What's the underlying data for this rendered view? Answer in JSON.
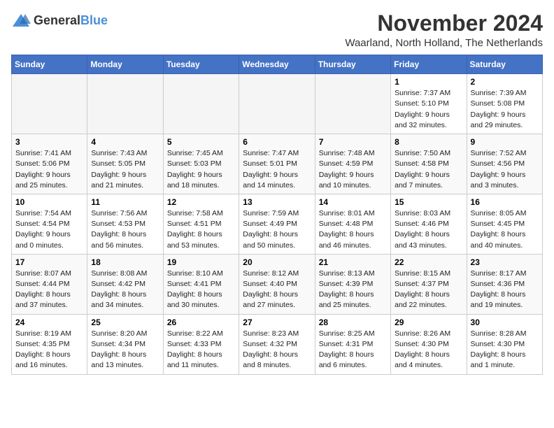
{
  "logo": {
    "general": "General",
    "blue": "Blue"
  },
  "title": "November 2024",
  "location": "Waarland, North Holland, The Netherlands",
  "days_of_week": [
    "Sunday",
    "Monday",
    "Tuesday",
    "Wednesday",
    "Thursday",
    "Friday",
    "Saturday"
  ],
  "weeks": [
    [
      {
        "day": "",
        "info": ""
      },
      {
        "day": "",
        "info": ""
      },
      {
        "day": "",
        "info": ""
      },
      {
        "day": "",
        "info": ""
      },
      {
        "day": "",
        "info": ""
      },
      {
        "day": "1",
        "info": "Sunrise: 7:37 AM\nSunset: 5:10 PM\nDaylight: 9 hours and 32 minutes."
      },
      {
        "day": "2",
        "info": "Sunrise: 7:39 AM\nSunset: 5:08 PM\nDaylight: 9 hours and 29 minutes."
      }
    ],
    [
      {
        "day": "3",
        "info": "Sunrise: 7:41 AM\nSunset: 5:06 PM\nDaylight: 9 hours and 25 minutes."
      },
      {
        "day": "4",
        "info": "Sunrise: 7:43 AM\nSunset: 5:05 PM\nDaylight: 9 hours and 21 minutes."
      },
      {
        "day": "5",
        "info": "Sunrise: 7:45 AM\nSunset: 5:03 PM\nDaylight: 9 hours and 18 minutes."
      },
      {
        "day": "6",
        "info": "Sunrise: 7:47 AM\nSunset: 5:01 PM\nDaylight: 9 hours and 14 minutes."
      },
      {
        "day": "7",
        "info": "Sunrise: 7:48 AM\nSunset: 4:59 PM\nDaylight: 9 hours and 10 minutes."
      },
      {
        "day": "8",
        "info": "Sunrise: 7:50 AM\nSunset: 4:58 PM\nDaylight: 9 hours and 7 minutes."
      },
      {
        "day": "9",
        "info": "Sunrise: 7:52 AM\nSunset: 4:56 PM\nDaylight: 9 hours and 3 minutes."
      }
    ],
    [
      {
        "day": "10",
        "info": "Sunrise: 7:54 AM\nSunset: 4:54 PM\nDaylight: 9 hours and 0 minutes."
      },
      {
        "day": "11",
        "info": "Sunrise: 7:56 AM\nSunset: 4:53 PM\nDaylight: 8 hours and 56 minutes."
      },
      {
        "day": "12",
        "info": "Sunrise: 7:58 AM\nSunset: 4:51 PM\nDaylight: 8 hours and 53 minutes."
      },
      {
        "day": "13",
        "info": "Sunrise: 7:59 AM\nSunset: 4:49 PM\nDaylight: 8 hours and 50 minutes."
      },
      {
        "day": "14",
        "info": "Sunrise: 8:01 AM\nSunset: 4:48 PM\nDaylight: 8 hours and 46 minutes."
      },
      {
        "day": "15",
        "info": "Sunrise: 8:03 AM\nSunset: 4:46 PM\nDaylight: 8 hours and 43 minutes."
      },
      {
        "day": "16",
        "info": "Sunrise: 8:05 AM\nSunset: 4:45 PM\nDaylight: 8 hours and 40 minutes."
      }
    ],
    [
      {
        "day": "17",
        "info": "Sunrise: 8:07 AM\nSunset: 4:44 PM\nDaylight: 8 hours and 37 minutes."
      },
      {
        "day": "18",
        "info": "Sunrise: 8:08 AM\nSunset: 4:42 PM\nDaylight: 8 hours and 34 minutes."
      },
      {
        "day": "19",
        "info": "Sunrise: 8:10 AM\nSunset: 4:41 PM\nDaylight: 8 hours and 30 minutes."
      },
      {
        "day": "20",
        "info": "Sunrise: 8:12 AM\nSunset: 4:40 PM\nDaylight: 8 hours and 27 minutes."
      },
      {
        "day": "21",
        "info": "Sunrise: 8:13 AM\nSunset: 4:39 PM\nDaylight: 8 hours and 25 minutes."
      },
      {
        "day": "22",
        "info": "Sunrise: 8:15 AM\nSunset: 4:37 PM\nDaylight: 8 hours and 22 minutes."
      },
      {
        "day": "23",
        "info": "Sunrise: 8:17 AM\nSunset: 4:36 PM\nDaylight: 8 hours and 19 minutes."
      }
    ],
    [
      {
        "day": "24",
        "info": "Sunrise: 8:19 AM\nSunset: 4:35 PM\nDaylight: 8 hours and 16 minutes."
      },
      {
        "day": "25",
        "info": "Sunrise: 8:20 AM\nSunset: 4:34 PM\nDaylight: 8 hours and 13 minutes."
      },
      {
        "day": "26",
        "info": "Sunrise: 8:22 AM\nSunset: 4:33 PM\nDaylight: 8 hours and 11 minutes."
      },
      {
        "day": "27",
        "info": "Sunrise: 8:23 AM\nSunset: 4:32 PM\nDaylight: 8 hours and 8 minutes."
      },
      {
        "day": "28",
        "info": "Sunrise: 8:25 AM\nSunset: 4:31 PM\nDaylight: 8 hours and 6 minutes."
      },
      {
        "day": "29",
        "info": "Sunrise: 8:26 AM\nSunset: 4:30 PM\nDaylight: 8 hours and 4 minutes."
      },
      {
        "day": "30",
        "info": "Sunrise: 8:28 AM\nSunset: 4:30 PM\nDaylight: 8 hours and 1 minute."
      }
    ]
  ]
}
